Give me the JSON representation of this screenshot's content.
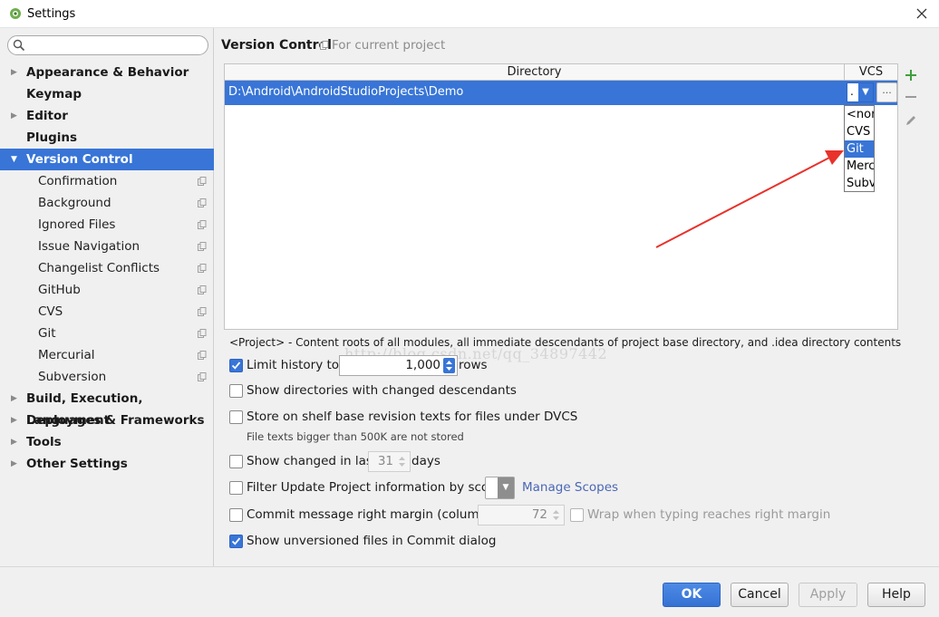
{
  "window": {
    "title": "Settings",
    "close_icon": "close-icon"
  },
  "sidebar": {
    "search_placeholder": "",
    "items": [
      {
        "label": "Appearance & Behavior",
        "level": "top",
        "expander": "collapsed"
      },
      {
        "label": "Keymap",
        "level": "top",
        "expander": "none"
      },
      {
        "label": "Editor",
        "level": "top",
        "expander": "collapsed"
      },
      {
        "label": "Plugins",
        "level": "top",
        "expander": "none"
      },
      {
        "label": "Version Control",
        "level": "top",
        "expander": "expanded",
        "selected": true
      },
      {
        "label": "Confirmation",
        "level": "sub",
        "project_icon": true
      },
      {
        "label": "Background",
        "level": "sub",
        "project_icon": true
      },
      {
        "label": "Ignored Files",
        "level": "sub",
        "project_icon": true
      },
      {
        "label": "Issue Navigation",
        "level": "sub",
        "project_icon": true
      },
      {
        "label": "Changelist Conflicts",
        "level": "sub",
        "project_icon": true
      },
      {
        "label": "GitHub",
        "level": "sub",
        "project_icon": true
      },
      {
        "label": "CVS",
        "level": "sub",
        "project_icon": true
      },
      {
        "label": "Git",
        "level": "sub",
        "project_icon": true
      },
      {
        "label": "Mercurial",
        "level": "sub",
        "project_icon": true
      },
      {
        "label": "Subversion",
        "level": "sub",
        "project_icon": true
      },
      {
        "label": "Build, Execution, Deployment",
        "level": "top",
        "expander": "collapsed"
      },
      {
        "label": "Languages & Frameworks",
        "level": "top",
        "expander": "collapsed"
      },
      {
        "label": "Tools",
        "level": "top",
        "expander": "collapsed"
      },
      {
        "label": "Other Settings",
        "level": "top",
        "expander": "collapsed"
      }
    ]
  },
  "main": {
    "title": "Version Control",
    "subtitle": "For current project",
    "table": {
      "headers": [
        "Directory",
        "VCS"
      ],
      "rows": [
        {
          "directory": "D:\\Android\\AndroidStudioProjects\\Demo",
          "vcs": "."
        }
      ],
      "browse_label": "...",
      "vcs_options": [
        "<none>",
        "CVS",
        "Git",
        "Mercurial",
        "Subversion"
      ],
      "vcs_highlighted": "Git"
    },
    "toolbar": {
      "add_icon": "plus-icon",
      "remove_icon": "minus-icon",
      "edit_icon": "pencil-icon"
    },
    "watermark": "http://blog.csdn.net/qq_34897442",
    "description": "<Project> - Content roots of all modules, all immediate descendants of project base directory, and .idea directory contents",
    "options": {
      "limit_history": {
        "checked": true,
        "label": "Limit history to:",
        "value": "1,000",
        "suffix": "rows"
      },
      "show_dirs": {
        "checked": false,
        "label": "Show directories with changed descendants"
      },
      "store_shelf": {
        "checked": false,
        "label": "Store on shelf base revision texts for files under DVCS",
        "note": "File texts bigger than 500K are not stored"
      },
      "show_changed": {
        "checked": false,
        "label": "Show changed in last",
        "value": "31",
        "suffix": "days"
      },
      "filter_update": {
        "checked": false,
        "label": "Filter Update Project information by scope",
        "link": "Manage Scopes"
      },
      "commit_margin": {
        "checked": false,
        "label": "Commit message right margin (columns):",
        "value": "72",
        "wrap_label": "Wrap when typing reaches right margin",
        "wrap_checked": false
      },
      "show_unversioned": {
        "checked": true,
        "label": "Show unversioned files in Commit dialog"
      }
    }
  },
  "footer": {
    "ok": "OK",
    "cancel": "Cancel",
    "apply": "Apply",
    "help": "Help"
  },
  "colors": {
    "accent": "#3875d7",
    "arrow": "#e8322b",
    "link": "#4a67b5"
  }
}
